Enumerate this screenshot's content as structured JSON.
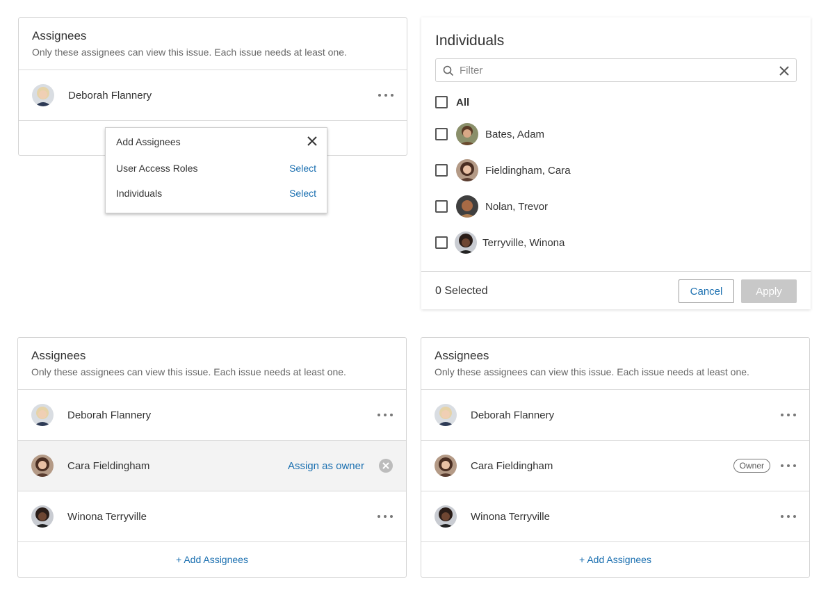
{
  "colors": {
    "link": "#1a6fb0",
    "border": "#d4d4d4",
    "apply_disabled": "#c8c8c8"
  },
  "card_top": {
    "title": "Assignees",
    "subtitle": "Only these assignees can view this issue. Each issue needs at least one.",
    "assignees": [
      {
        "name": "Deborah Flannery"
      }
    ]
  },
  "popup": {
    "title": "Add Assignees",
    "rows": [
      {
        "label": "User Access Roles",
        "action": "Select"
      },
      {
        "label": "Individuals",
        "action": "Select"
      }
    ]
  },
  "individuals": {
    "title": "Individuals",
    "filter_placeholder": "Filter",
    "all_label": "All",
    "people": [
      {
        "name": "Bates, Adam"
      },
      {
        "name": "Fieldingham, Cara"
      },
      {
        "name": "Nolan, Trevor"
      },
      {
        "name": "Terryville, Winona"
      }
    ],
    "selected_count": "0 Selected",
    "cancel_label": "Cancel",
    "apply_label": "Apply"
  },
  "card_bl": {
    "title": "Assignees",
    "subtitle": "Only these assignees can view this issue. Each issue needs at least one.",
    "assignees": [
      {
        "name": "Deborah Flannery"
      },
      {
        "name": "Cara Fieldingham",
        "action": "Assign as owner"
      },
      {
        "name": "Winona Terryville"
      }
    ],
    "add_label": "+ Add Assignees"
  },
  "card_br": {
    "title": "Assignees",
    "subtitle": "Only these assignees can view this issue. Each issue needs at least one.",
    "assignees": [
      {
        "name": "Deborah Flannery"
      },
      {
        "name": "Cara Fieldingham",
        "badge": "Owner"
      },
      {
        "name": "Winona Terryville"
      }
    ],
    "add_label": "+ Add Assignees"
  }
}
